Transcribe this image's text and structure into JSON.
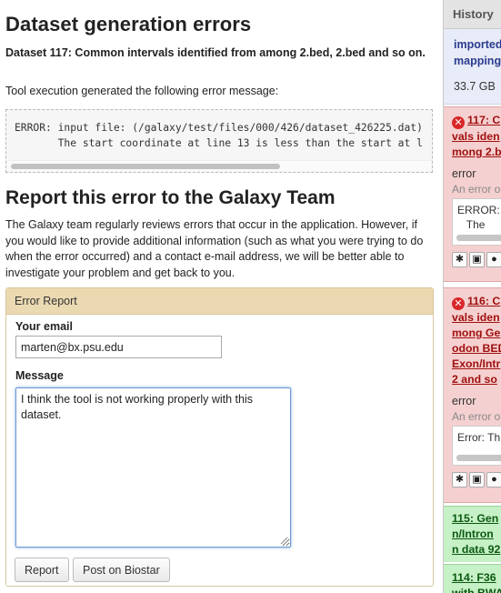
{
  "main": {
    "title": "Dataset generation errors",
    "subtitle": "Dataset 117: Common intervals identified from among 2.bed, 2.bed and so on.",
    "intro": "Tool execution generated the following error message:",
    "error_message": "ERROR: input file: (/galaxy/test/files/000/426/dataset_426225.dat)\n       The start coordinate at line 13 is less than the start at l",
    "report_title": "Report this error to the Galaxy Team",
    "report_description": "The Galaxy team regularly reviews errors that occur in the application. However, if you would like to provide additional information (such as what you were trying to do when the error occurred) and a contact e-mail address, we will be better able to investigate your problem and get back to you.",
    "form": {
      "panel_title": "Error Report",
      "email_label": "Your email",
      "email_value": "marten@bx.psu.edu",
      "message_label": "Message",
      "message_value": "I think the tool is not working properly with this dataset.",
      "report_button": "Report",
      "biostar_button": "Post on Biostar"
    }
  },
  "history": {
    "header": "History",
    "name": "imported\nmapping",
    "size": "33.7 GB",
    "datasets": [
      {
        "title": "117: C\nvals iden\nmong 2.b",
        "state": "error",
        "note": "An error o",
        "peek": "ERROR: i\n   The"
      },
      {
        "title": "116: C\nvals iden\nmong Ge\nodon BED\nExon/Intr\n2 and so",
        "state": "error",
        "note": "An error o",
        "peek": "Error: Th"
      },
      {
        "title": "115: Gen\nn/Intron\nn data 92"
      },
      {
        "title": "114: F36\nwith BWA"
      }
    ]
  },
  "colors": {
    "error_bg": "#f5d0d0",
    "ok_bg": "#c6f0c6",
    "panel_header": "#ebd9b2",
    "history_info": "#e8ecf8"
  },
  "icons": [
    "error-icon",
    "bug-icon",
    "save-icon",
    "info-icon"
  ]
}
